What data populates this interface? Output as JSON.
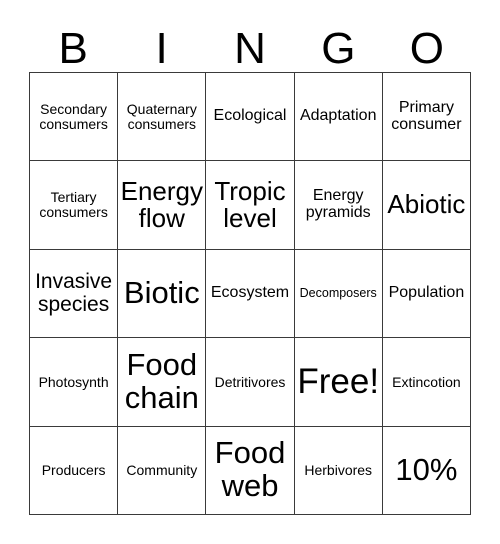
{
  "card": {
    "title": "BINGO",
    "header_letters": [
      "B",
      "I",
      "N",
      "G",
      "O"
    ],
    "rows": [
      [
        {
          "label": "Secondary consumers",
          "size": "sm"
        },
        {
          "label": "Quaternary consumers",
          "size": "sm"
        },
        {
          "label": "Ecological",
          "size": "md"
        },
        {
          "label": "Adaptation",
          "size": "md"
        },
        {
          "label": "Primary consumer",
          "size": "md"
        }
      ],
      [
        {
          "label": "Tertiary consumers",
          "size": "sm"
        },
        {
          "label": "Energy flow",
          "size": "xl"
        },
        {
          "label": "Tropic level",
          "size": "xl"
        },
        {
          "label": "Energy pyramids",
          "size": "md"
        },
        {
          "label": "Abiotic",
          "size": "xl"
        }
      ],
      [
        {
          "label": "Invasive species",
          "size": "lg"
        },
        {
          "label": "Biotic",
          "size": "xxl"
        },
        {
          "label": "Ecosystem",
          "size": "md"
        },
        {
          "label": "Decomposers",
          "size": "xs"
        },
        {
          "label": "Population",
          "size": "md"
        }
      ],
      [
        {
          "label": "Photosynth",
          "size": "sm"
        },
        {
          "label": "Food chain",
          "size": "xxl"
        },
        {
          "label": "Detritivores",
          "size": "sm"
        },
        {
          "label": "Free!",
          "size": "huge"
        },
        {
          "label": "Extincotion",
          "size": "sm"
        }
      ],
      [
        {
          "label": "Producers",
          "size": "sm"
        },
        {
          "label": "Community",
          "size": "sm"
        },
        {
          "label": "Food web",
          "size": "xxl"
        },
        {
          "label": "Herbivores",
          "size": "sm"
        },
        {
          "label": "10%",
          "size": "xxl"
        }
      ]
    ],
    "free_space": "Free!",
    "colors": {
      "background": "#ffffff",
      "text": "#000000",
      "grid_line": "#3a3a3a"
    }
  }
}
